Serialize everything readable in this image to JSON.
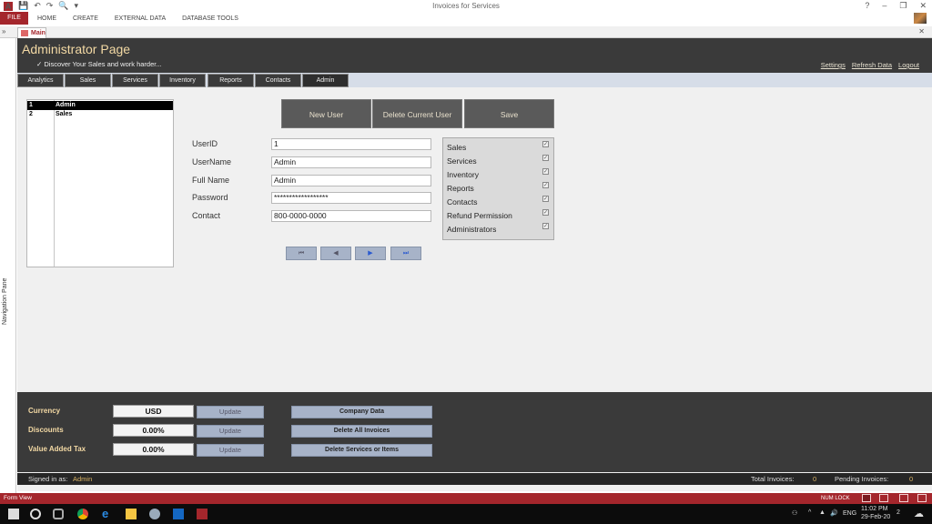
{
  "window": {
    "title": "Invoices for Services",
    "controls": [
      "?",
      "–",
      "❐",
      "✕"
    ]
  },
  "ribbon": {
    "file": "FILE",
    "tabs": [
      "HOME",
      "CREATE",
      "EXTERNAL DATA",
      "DATABASE TOOLS"
    ]
  },
  "document_tab": {
    "label": "Main",
    "nav_toggle": "»",
    "close": "✕"
  },
  "nav_pane": {
    "label": "Navigation Pane"
  },
  "header": {
    "title": "Administrator Page",
    "subtitle": "✓ Discover Your Sales and work harder...",
    "links": [
      "Settings",
      "Refresh Data",
      "Logout"
    ]
  },
  "tabs": [
    "Analytics",
    "Sales",
    "Services",
    "Inventory",
    "Reports",
    "Contacts",
    "Admin"
  ],
  "active_tab": "Admin",
  "user_list": [
    {
      "id": "1",
      "name": "Admin",
      "selected": true
    },
    {
      "id": "2",
      "name": "Sales",
      "selected": false
    }
  ],
  "actions": {
    "new_user": "New User",
    "delete_user": "Delete Current User",
    "save": "Save"
  },
  "fields": [
    {
      "label": "UserID",
      "value": "1"
    },
    {
      "label": "UserName",
      "value": "Admin"
    },
    {
      "label": "Full Name",
      "value": "Admin"
    },
    {
      "label": "Password",
      "value": "******************"
    },
    {
      "label": "Contact",
      "value": "800-0000-0000"
    }
  ],
  "permissions": [
    {
      "label": "Sales",
      "checked": true
    },
    {
      "label": "Services",
      "checked": true
    },
    {
      "label": "Inventory",
      "checked": true
    },
    {
      "label": "Reports",
      "checked": true
    },
    {
      "label": "Contacts",
      "checked": true
    },
    {
      "label": "Refund Permission",
      "checked": true
    },
    {
      "label": "Administrators",
      "checked": true
    }
  ],
  "record_nav": {
    "first": "⏮",
    "prev": "◀",
    "next": "▶",
    "last": "⏭"
  },
  "settings": [
    {
      "label": "Currency",
      "value": "USD",
      "button": "Update"
    },
    {
      "label": "Discounts",
      "value": "0.00%",
      "button": "Update"
    },
    {
      "label": "Value Added Tax",
      "value": "0.00%",
      "button": "Update"
    }
  ],
  "admin_actions": [
    "Company Data",
    "Delete All Invoices",
    "Delete Services or Items"
  ],
  "statusline": {
    "signed_in_label": "Signed in as:",
    "signed_in_user": "Admin",
    "total_invoices_label": "Total Invoices:",
    "total_invoices": "0",
    "pending_invoices_label": "Pending Invoices:",
    "pending_invoices": "0"
  },
  "access_status": {
    "view": "Form View",
    "numlock": "NUM LOCK"
  },
  "taskbar": {
    "time": "11:02 PM",
    "date": "29-Feb-20",
    "lang": "ENG",
    "notifications": "2"
  }
}
